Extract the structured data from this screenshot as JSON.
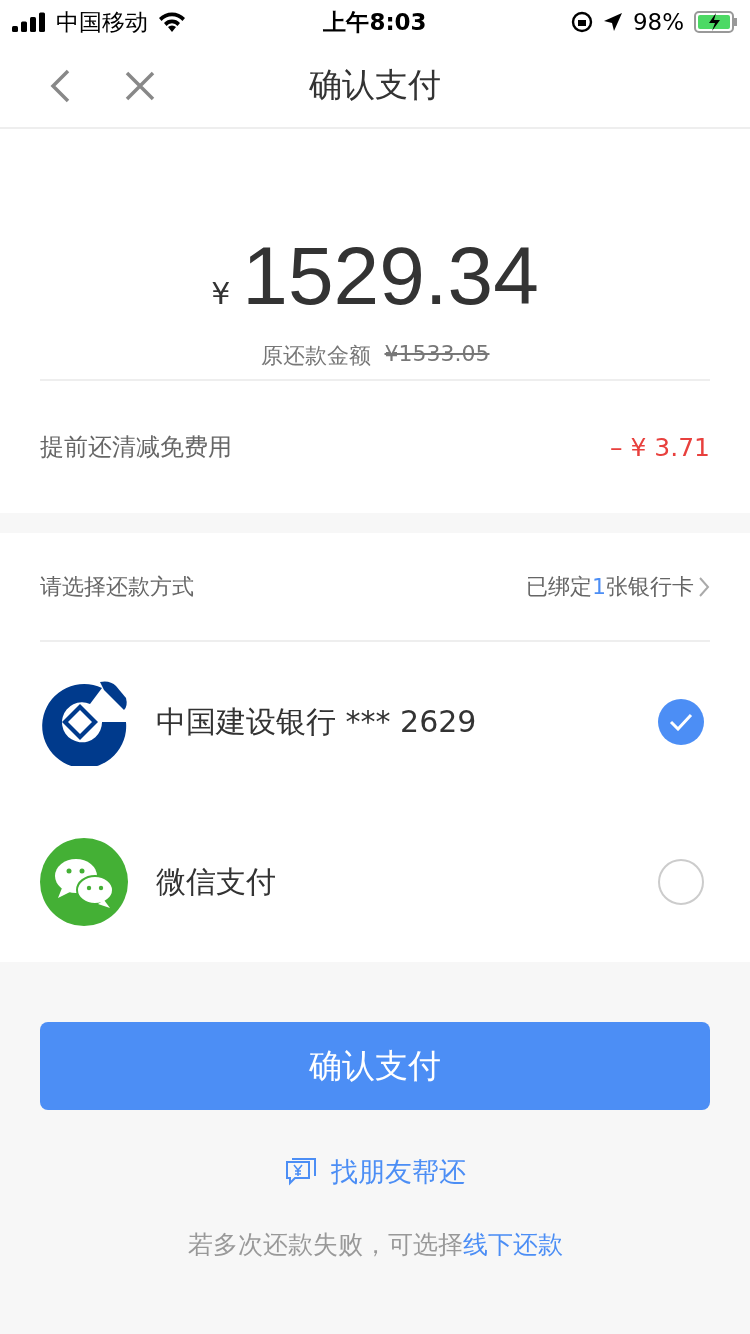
{
  "status_bar": {
    "carrier": "中国移动",
    "time": "上午8:03",
    "battery": "98%"
  },
  "nav": {
    "title": "确认支付"
  },
  "amount": {
    "currency": "¥",
    "value": "1529.34",
    "original_label": "原还款金额",
    "original_value": "¥1533.05"
  },
  "fee": {
    "label": "提前还清减免费用",
    "value": "– ¥ 3.71"
  },
  "payment": {
    "heading": "请选择还款方式",
    "bound_prefix": "已绑定",
    "bound_count": "1",
    "bound_suffix": "张银行卡",
    "methods": [
      {
        "kind": "bank",
        "label": "中国建设银行 *** 2629",
        "selected": true
      },
      {
        "kind": "wechat",
        "label": "微信支付",
        "selected": false
      }
    ]
  },
  "confirm_button": "确认支付",
  "friend_link": "找朋友帮还",
  "footer": {
    "text": "若多次还款失败，可选择",
    "link": "线下还款"
  }
}
